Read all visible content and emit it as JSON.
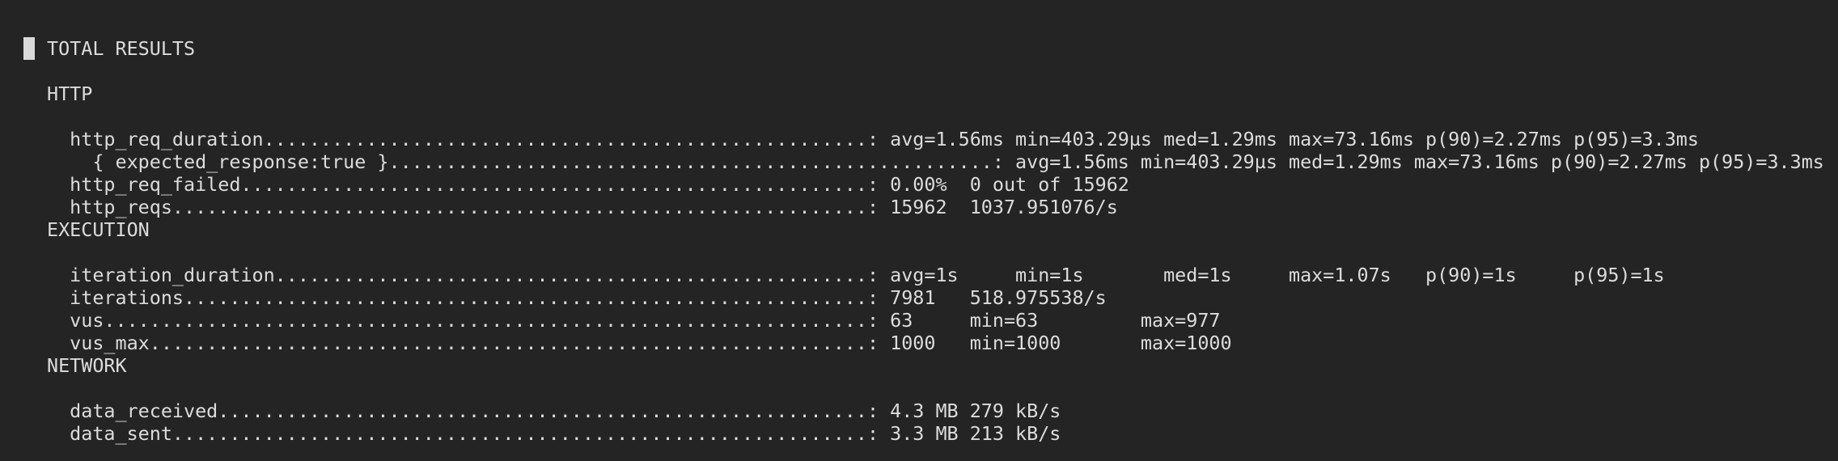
{
  "header": {
    "title": "TOTAL RESULTS"
  },
  "sections": [
    {
      "name": "HTTP",
      "rows": [
        {
          "label": "http_req_duration",
          "value": "avg=1.56ms min=403.29µs med=1.29ms max=73.16ms p(90)=2.27ms p(95)=3.3ms"
        },
        {
          "label": "  { expected_response:true }",
          "value": "avg=1.56ms min=403.29µs med=1.29ms max=73.16ms p(90)=2.27ms p(95)=3.3ms"
        },
        {
          "label": "http_req_failed",
          "value": "0.00%  0 out of 15962"
        },
        {
          "label": "http_reqs",
          "value": "15962  1037.951076/s"
        }
      ]
    },
    {
      "name": "EXECUTION",
      "rows": [
        {
          "label": "iteration_duration",
          "value": "avg=1s     min=1s       med=1s     max=1.07s   p(90)=1s     p(95)=1s"
        },
        {
          "label": "iterations",
          "value": "7981   518.975538/s"
        },
        {
          "label": "vus",
          "value": "63     min=63         max=977"
        },
        {
          "label": "vus_max",
          "value": "1000   min=1000       max=1000"
        }
      ]
    },
    {
      "name": "NETWORK",
      "rows": [
        {
          "label": "data_received",
          "value": "4.3 MB 279 kB/s"
        },
        {
          "label": "data_sent",
          "value": "3.3 MB 213 kB/s"
        }
      ]
    }
  ]
}
